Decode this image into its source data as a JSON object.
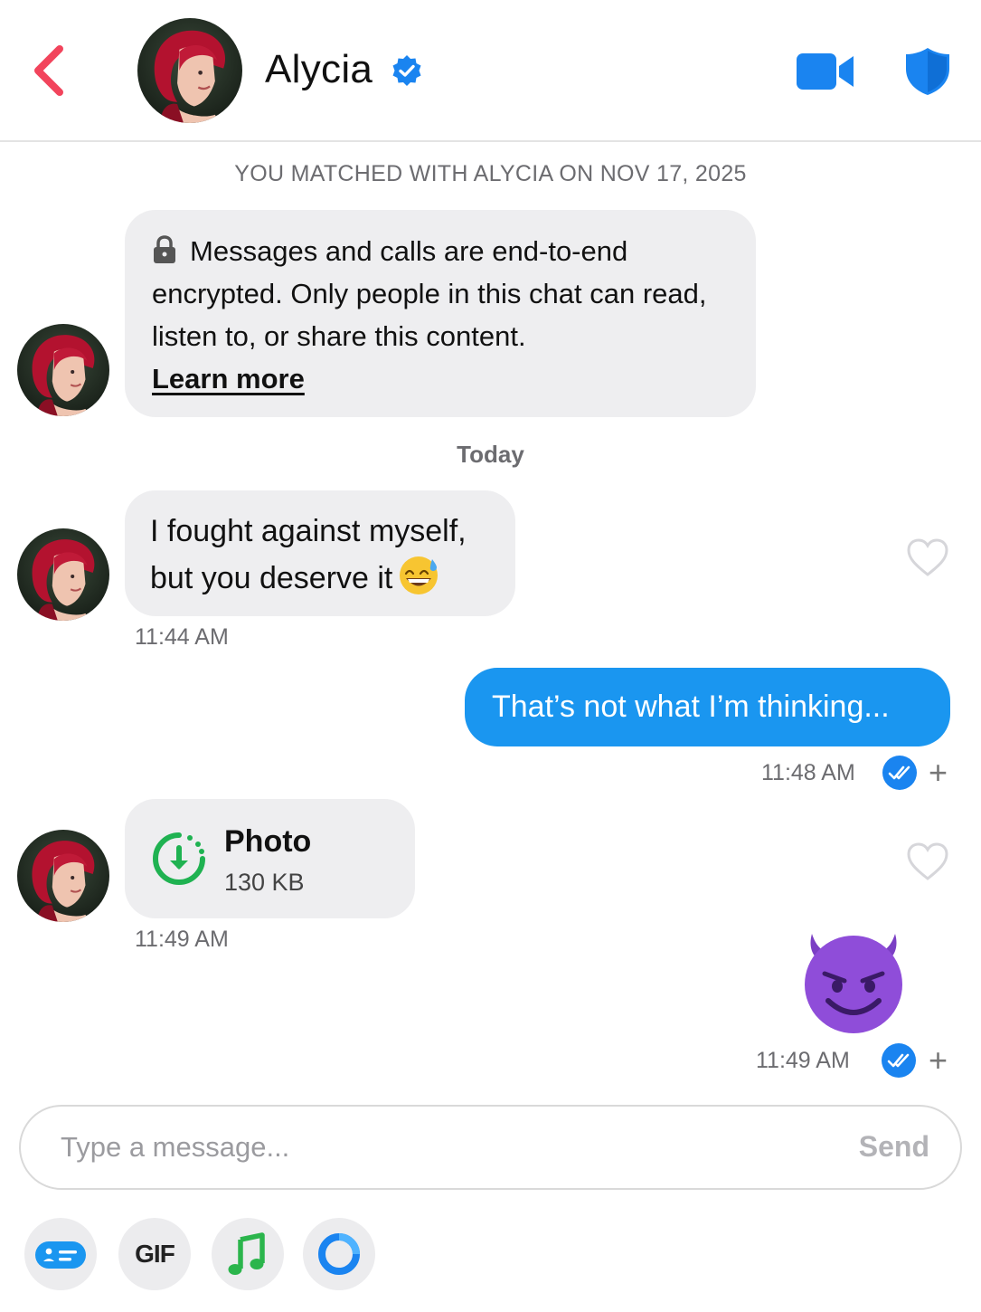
{
  "header": {
    "name": "Alycia",
    "icons": {
      "back": "chevron-left-icon",
      "verified": "verified-badge-icon",
      "video": "video-camera-icon",
      "safety": "shield-icon"
    },
    "colors": {
      "back": "#f2445c",
      "accent": "#1a84f0"
    }
  },
  "chat": {
    "matched_banner": "YOU MATCHED WITH ALYCIA ON NOV 17, 2025",
    "encryption": {
      "text": "Messages and calls are end-to-end encrypted. Only people in this chat can read, listen to, or share this content.",
      "link": "Learn more"
    },
    "day_separator": "Today",
    "messages": [
      {
        "from": "them",
        "text": "I fought against myself, but you deserve it",
        "emoji": "grinning-sweat-emoji",
        "time": "11:44 AM",
        "liked": false
      },
      {
        "from": "me",
        "text": "That’s not what I’m thinking...",
        "time": "11:48 AM",
        "status": "read"
      },
      {
        "from": "them",
        "type": "attachment",
        "title": "Photo",
        "size": "130 KB",
        "time": "11:49 AM",
        "liked": false
      },
      {
        "from": "me",
        "type": "emoji",
        "emoji": "smiling-devil-emoji",
        "time": "11:49 AM",
        "status": "read"
      }
    ],
    "add_reaction": "+"
  },
  "composer": {
    "placeholder": "Type a message...",
    "send_label": "Send"
  },
  "toolbar": {
    "gif_label": "GIF",
    "items": [
      "sticker-card-icon",
      "gif-icon",
      "music-note-icon",
      "loop-ring-icon"
    ]
  },
  "colors": {
    "outgoing_bubble": "#1a96f0",
    "incoming_bubble": "#eeeef0",
    "read_check": "#1a84f0",
    "music": "#2bb54c"
  }
}
